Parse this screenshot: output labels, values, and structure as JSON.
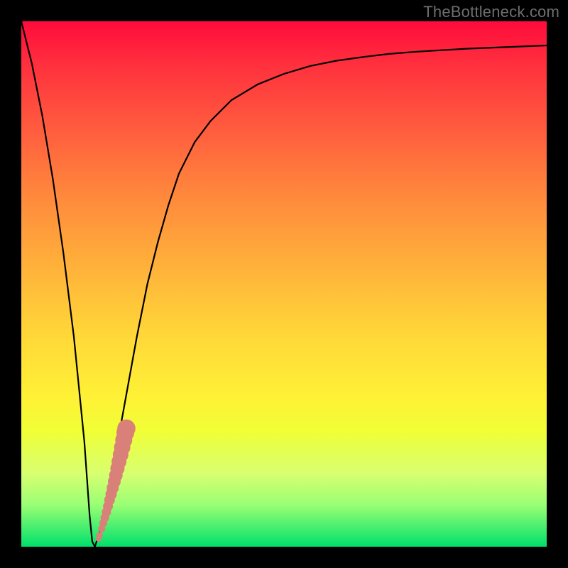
{
  "watermark": "TheBottleneck.com",
  "colors": {
    "frame": "#000000",
    "curve": "#000000",
    "marker": "#d98078"
  },
  "chart_data": {
    "type": "line",
    "title": "",
    "xlabel": "",
    "ylabel": "",
    "xlim": [
      0,
      100
    ],
    "ylim": [
      0,
      100
    ],
    "grid": false,
    "series": [
      {
        "name": "bottleneck-curve",
        "x": [
          0,
          2,
          4,
          6,
          8,
          10,
          12,
          13,
          13.5,
          14,
          15,
          16,
          18,
          20,
          22,
          24,
          26,
          28,
          30,
          33,
          36,
          40,
          45,
          50,
          55,
          60,
          65,
          70,
          75,
          80,
          85,
          90,
          95,
          100
        ],
        "values": [
          100,
          92,
          82,
          70,
          56,
          40,
          20,
          6,
          1,
          0,
          3,
          8,
          18,
          29,
          40,
          50,
          58,
          65,
          71,
          77,
          81,
          85,
          88,
          90,
          91.5,
          92.5,
          93.2,
          93.8,
          94.2,
          94.5,
          94.8,
          95.0,
          95.2,
          95.4
        ]
      }
    ],
    "markers": {
      "name": "highlighted-segment",
      "shape": "circle",
      "color": "#d98078",
      "x": [
        14.7,
        14.9,
        15.3,
        15.6,
        15.9,
        16.2,
        16.5,
        16.8,
        17.1,
        17.4,
        17.7,
        18.0,
        18.3,
        18.6,
        18.9,
        19.2,
        19.5,
        19.8,
        20.0
      ],
      "values": [
        1.5,
        2.2,
        3.4,
        4.5,
        5.5,
        6.6,
        7.7,
        8.9,
        10.0,
        11.2,
        12.4,
        13.6,
        14.9,
        16.2,
        17.5,
        18.9,
        20.3,
        21.7,
        22.5
      ],
      "radius": [
        4,
        4.5,
        5,
        5.5,
        6,
        6.5,
        7,
        7.5,
        8,
        8.5,
        9,
        9.5,
        10,
        10.5,
        11,
        11.5,
        12,
        12.5,
        12.8
      ]
    }
  }
}
